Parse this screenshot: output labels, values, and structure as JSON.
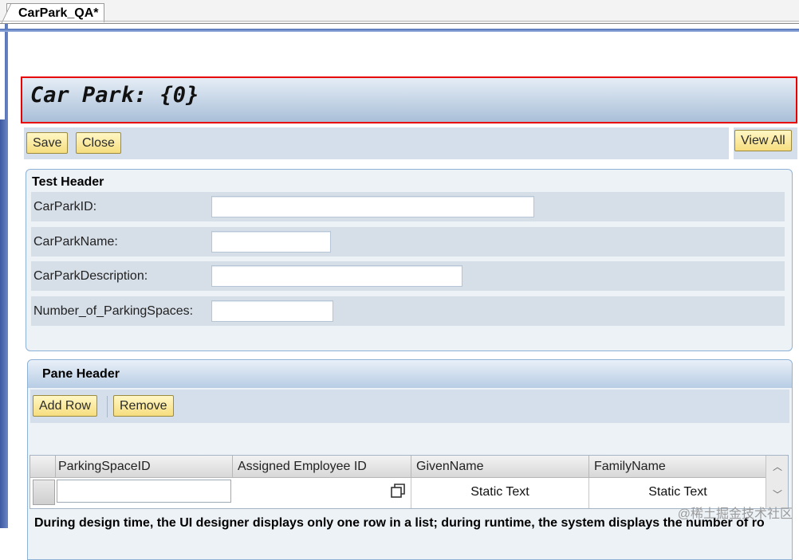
{
  "tab": {
    "label": "CarPark_QA*"
  },
  "title": "Car Park: {0}",
  "toolbar": {
    "save_label": "Save",
    "close_label": "Close",
    "view_all_label": "View All"
  },
  "header_section": {
    "title": "Test Header",
    "fields": [
      {
        "label": "CarParkID:",
        "value": ""
      },
      {
        "label": "CarParkName:",
        "value": ""
      },
      {
        "label": "CarParkDescription:",
        "value": ""
      },
      {
        "label": "Number_of_ParkingSpaces:",
        "value": ""
      }
    ]
  },
  "pane": {
    "title": "Pane Header",
    "add_row_label": "Add Row",
    "remove_label": "Remove",
    "columns": [
      "ParkingSpaceID",
      "Assigned Employee ID",
      "GivenName",
      "FamilyName"
    ],
    "row": {
      "parking_space_id": "",
      "assigned_employee_id": "",
      "given_name": "Static Text",
      "family_name": "Static Text"
    },
    "note": "During design time, the UI designer displays only one row in a list; during runtime, the system displays the number of ro"
  },
  "icons": {
    "value_help": "value-help-icon",
    "scroll_up": "chevron-up-icon",
    "scroll_down": "chevron-down-icon"
  },
  "colors": {
    "title_border": "#e60000",
    "button_fill": "#f6de7e",
    "section_bg": "#edf2f7",
    "row_bg": "#d6dee8"
  },
  "watermark": "@稀土掘金技术社区"
}
